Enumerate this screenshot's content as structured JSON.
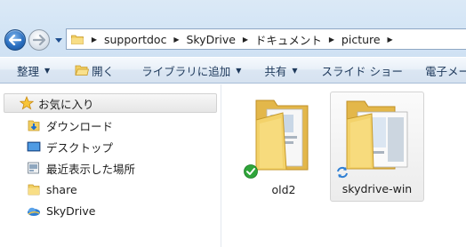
{
  "address": {
    "back_icon": "back-arrow-icon",
    "forward_icon": "forward-arrow-icon",
    "crumbs": [
      "supportdoc",
      "SkyDrive",
      "ドキュメント",
      "picture"
    ]
  },
  "toolbar": {
    "organize": "整理",
    "open": "開く",
    "add_library": "ライブラリに追加",
    "share": "共有",
    "slideshow": "スライド ショー",
    "email": "電子メール"
  },
  "nav": {
    "favorites": "お気に入り",
    "items": [
      {
        "label": "ダウンロード",
        "icon": "download-folder-icon"
      },
      {
        "label": "デスクトップ",
        "icon": "desktop-icon"
      },
      {
        "label": "最近表示した場所",
        "icon": "recent-places-icon"
      },
      {
        "label": "share",
        "icon": "folder-icon"
      },
      {
        "label": "SkyDrive",
        "icon": "skydrive-icon"
      }
    ]
  },
  "files": [
    {
      "name": "old2",
      "status": "synced-check-icon",
      "selected": false
    },
    {
      "name": "skydrive-win",
      "status": "syncing-icon",
      "selected": true
    }
  ],
  "colors": {
    "toolbar_text": "#1e395b",
    "selection_bg": "#ececec",
    "folder": "#f3d26a"
  }
}
